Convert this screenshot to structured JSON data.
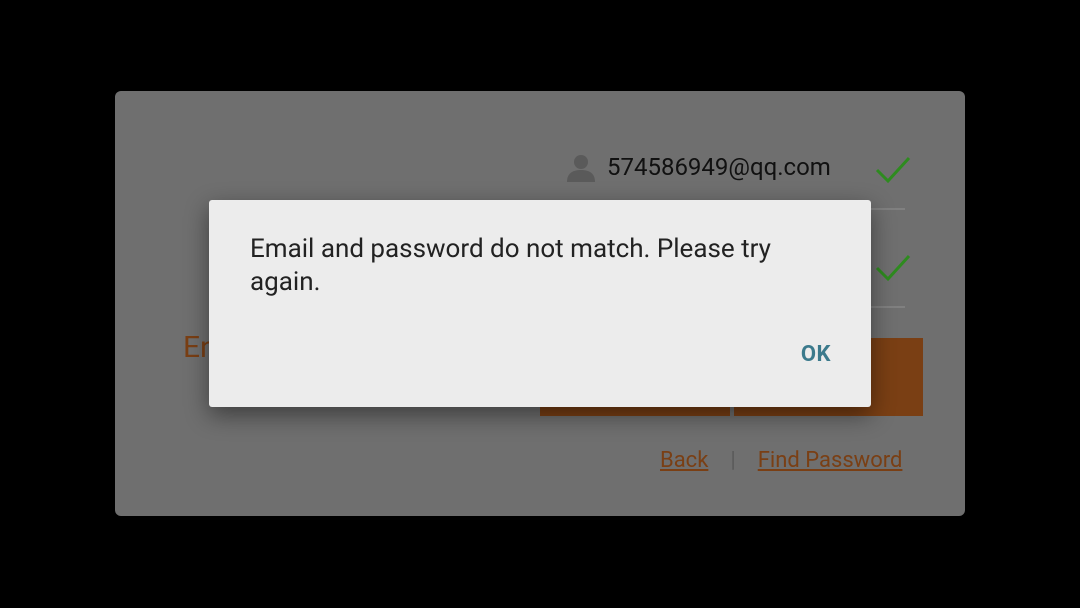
{
  "login": {
    "email_value": "574586949@qq.com",
    "partial_label": "En",
    "back_link": "Back",
    "separator": "|",
    "find_password_link": "Find Password"
  },
  "icons": {
    "user": "user-icon",
    "check": "checkmark-icon"
  },
  "colors": {
    "accent_orange": "#7a3f14",
    "check_green": "#2e8b1f",
    "ok_teal": "#3b7a8c",
    "dialog_bg": "#ececec"
  },
  "dialog": {
    "message": "Email and password do not match. Please try again.",
    "ok_label": "OK"
  }
}
